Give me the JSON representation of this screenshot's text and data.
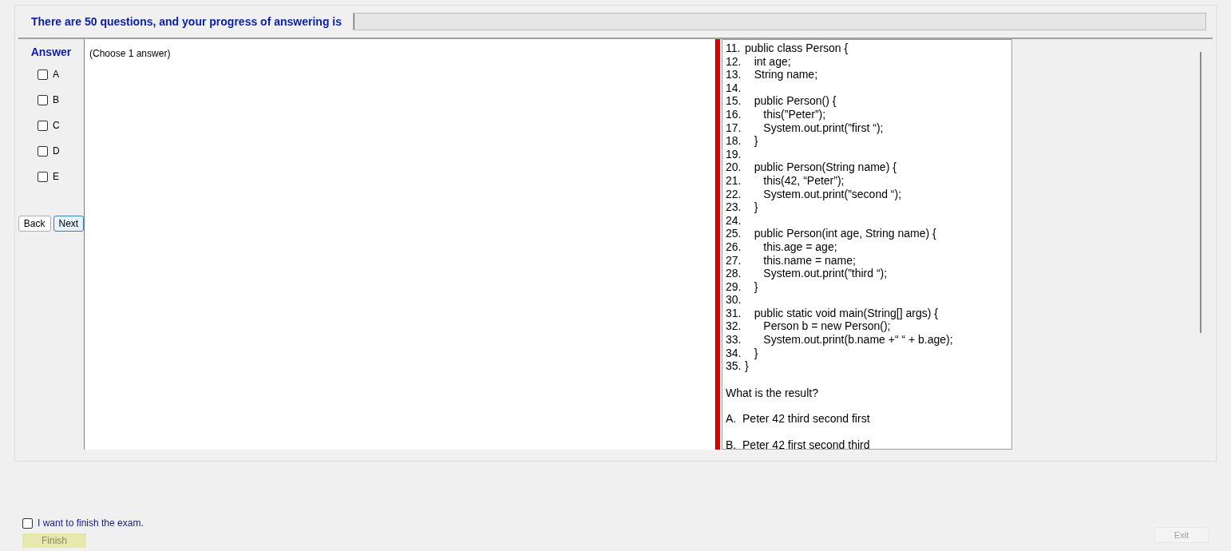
{
  "header": {
    "text": "There are 50 questions, and your progress of answering is",
    "progress": {
      "level": 0
    }
  },
  "answer_panel": {
    "title": "Answer",
    "options": [
      {
        "label": "A",
        "checked": false
      },
      {
        "label": "B",
        "checked": false
      },
      {
        "label": "C",
        "checked": false
      },
      {
        "label": "D",
        "checked": false
      },
      {
        "label": "E",
        "checked": false
      }
    ],
    "buttons": [
      {
        "label": "Back",
        "selected": false
      },
      {
        "label": "Next",
        "selected": true
      }
    ]
  },
  "instruction": "(Choose 1 answer)",
  "question": {
    "code_lines": [
      {
        "number": "11.",
        "code": "public class Person {"
      },
      {
        "number": "12.",
        "code": "   int age;"
      },
      {
        "number": "13.",
        "code": "   String name;"
      },
      {
        "number": "14."
      },
      {
        "number": "15.",
        "code": "   public Person() {"
      },
      {
        "number": "16.",
        "code": "      this(”Peter”);"
      },
      {
        "number": "17.",
        "code": "      System.out.print(”first “);"
      },
      {
        "number": "18.",
        "code": "   }"
      },
      {
        "number": "19."
      },
      {
        "number": "20.",
        "code": "   public Person(String name) {"
      },
      {
        "number": "21.",
        "code": "      this(42, “Peter”);"
      },
      {
        "number": "22.",
        "code": "      System.out.print(”second “);"
      },
      {
        "number": "23.",
        "code": "   }"
      },
      {
        "number": "24."
      },
      {
        "number": "25.",
        "code": "   public Person(int age, String name) {"
      },
      {
        "number": "26.",
        "code": "      this.age = age;"
      },
      {
        "number": "27.",
        "code": "      this.name = name;"
      },
      {
        "number": "28.",
        "code": "      System.out.print(”third “);"
      },
      {
        "number": "29.",
        "code": "   }"
      },
      {
        "number": "30."
      },
      {
        "number": "31.",
        "code": "   public static void main(String[] args) {"
      },
      {
        "number": "32.",
        "code": "      Person b = new Person();"
      },
      {
        "number": "33.",
        "code": "      System.out.print(b.name +“ “ + b.age);"
      },
      {
        "number": "34.",
        "code": "   }"
      },
      {
        "number": "35.",
        "code": "}"
      }
    ],
    "prompt": "What is the result?",
    "choices": [
      "A.  Peter 42 third second first",
      "B.  Peter 42 first second third"
    ]
  },
  "footer": {
    "finish_checkbox": {
      "label": "I want to finish the exam.",
      "checked": false
    },
    "finish_button": {
      "label": "Finish",
      "disabled": true
    },
    "exit_button": {
      "label": "Exit",
      "disabled": true
    }
  }
}
